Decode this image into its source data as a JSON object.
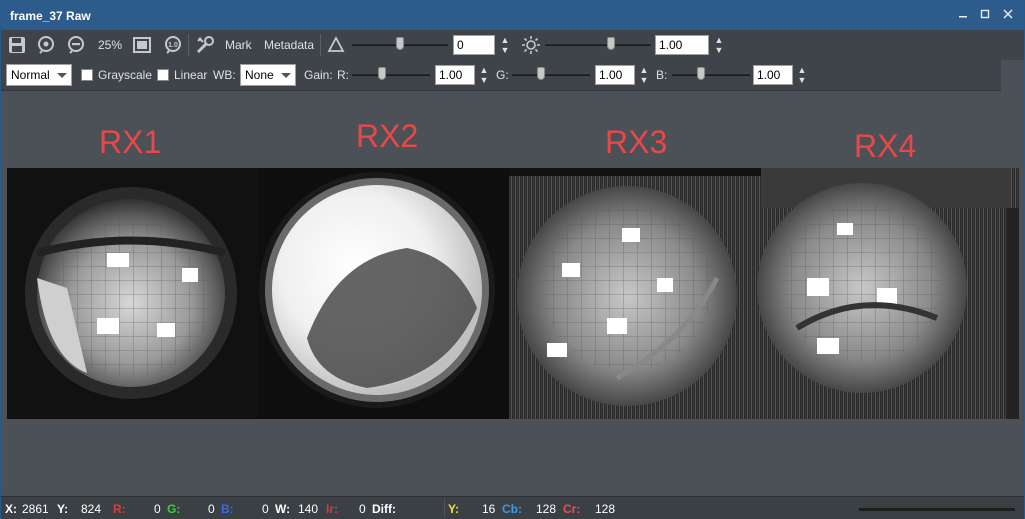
{
  "window": {
    "title": "frame_37 Raw"
  },
  "toolbar1": {
    "zoom": "25%",
    "mark_label": "Mark",
    "metadata_label": "Metadata",
    "contrast_value": "0",
    "brightness_value": "1.00",
    "contrast_level": 0.5,
    "brightness_level": 0.5
  },
  "toolbar2": {
    "mode_selected": "Normal",
    "grayscale_label": "Grayscale",
    "linear_label": "Linear",
    "wb_label": "WB:",
    "wb_selected": "None",
    "gain_label": "Gain:",
    "r_label": "R:",
    "g_label": "G:",
    "b_label": "B:",
    "gain_r": "1.00",
    "gain_g": "1.00",
    "gain_b": "1.00"
  },
  "viewer": {
    "labels": [
      "RX1",
      "RX2",
      "RX3",
      "RX4"
    ],
    "label_color": "#e84848"
  },
  "status": {
    "x_label": "X:",
    "x_value": "2861",
    "y_label": "Y:",
    "y_value": "824",
    "r_label": "R:",
    "r_value": "0",
    "g_label": "G:",
    "g_value": "0",
    "b_label": "B:",
    "b_value": "0",
    "w_label": "W:",
    "w_value": "140",
    "ir_label": "Ir:",
    "ir_value": "0",
    "diff_label": "Diff:",
    "yy_label": "Y:",
    "yy_value": "16",
    "cb_label": "Cb:",
    "cb_value": "128",
    "cr_label": "Cr:",
    "cr_value": "128"
  },
  "colors": {
    "title_bar": "#2d5b8b",
    "r": "#e03a3a",
    "g": "#3ad03a",
    "b": "#3a6ae8",
    "y": "#f0e040",
    "cb": "#3a9ae8",
    "cr": "#e85050"
  }
}
